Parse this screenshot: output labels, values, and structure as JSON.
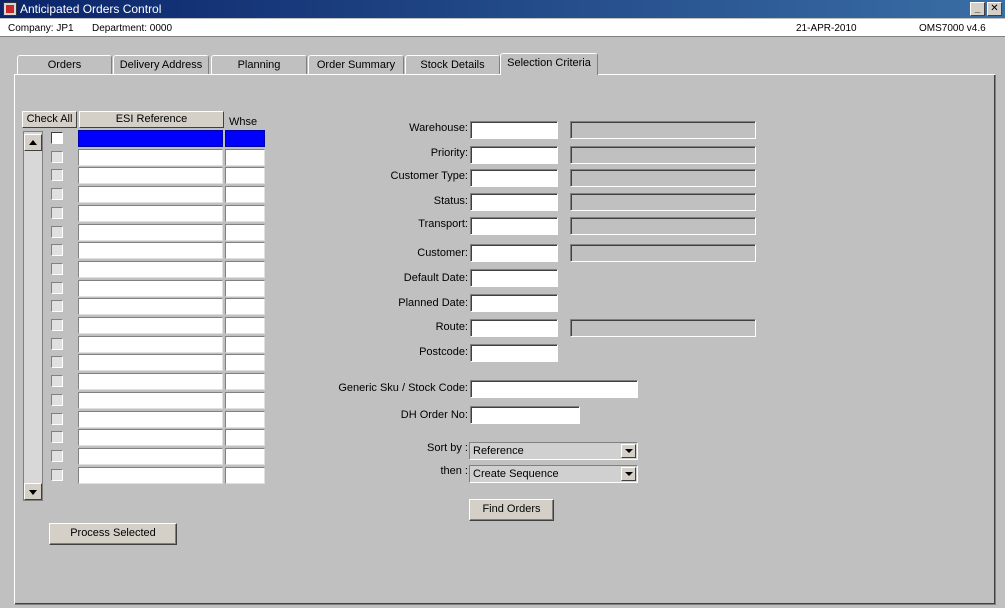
{
  "window": {
    "title": "Anticipated Orders Control",
    "min_label": "_",
    "close_label": "✕"
  },
  "info": {
    "company": "Company: JP1",
    "department": "Department: 0000",
    "date": "21-APR-2010",
    "version": "OMS7000 v4.6"
  },
  "tabs": [
    {
      "label": "Orders"
    },
    {
      "label": "Delivery Address"
    },
    {
      "label": "Planning"
    },
    {
      "label": "Order Summary"
    },
    {
      "label": "Stock Details"
    },
    {
      "label": "Selection Criteria"
    }
  ],
  "grid": {
    "check_all_label": "Check All",
    "ref_header": "ESI Reference",
    "whse_header": "Whse",
    "row_count": 19
  },
  "criteria": {
    "warehouse": "Warehouse:",
    "priority": "Priority:",
    "customer_type": "Customer Type:",
    "status": "Status:",
    "transport": "Transport:",
    "customer": "Customer:",
    "default_date": "Default Date:",
    "planned_date": "Planned Date:",
    "route": "Route:",
    "postcode": "Postcode:",
    "generic_sku": "Generic Sku / Stock Code:",
    "dh_order": "DH Order No:",
    "sort_by": "Sort by :",
    "then": "then :"
  },
  "sort": {
    "sort_by_value": "Reference",
    "then_value": "Create Sequence"
  },
  "buttons": {
    "find_orders": "Find Orders",
    "process_selected": "Process Selected"
  },
  "colors": {
    "selection": "#0000ff",
    "face": "#c0c0c0",
    "title_start": "#0a246a"
  }
}
